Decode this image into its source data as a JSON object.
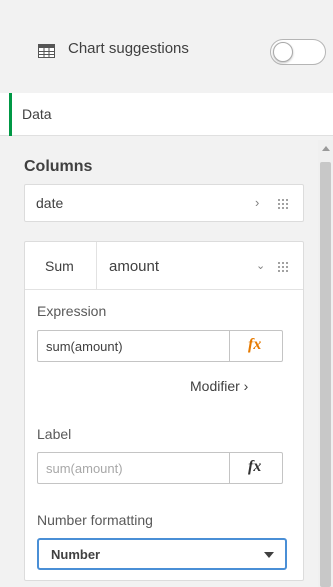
{
  "header": {
    "icon": "table-icon",
    "label": "Chart suggestions",
    "toggle_on": false
  },
  "tabs": {
    "data_label": "Data"
  },
  "columns": {
    "title": "Columns",
    "dimension": {
      "label": "date",
      "chevron": "›"
    }
  },
  "measure": {
    "aggregation": "Sum",
    "field": "amount",
    "chevron": "⌄",
    "expression": {
      "label": "Expression",
      "value": "sum(amount)",
      "fx": "fx",
      "fx_color": "#e67a00"
    },
    "modifier": "Modifier  ›",
    "label_section": {
      "label": "Label",
      "placeholder": "sum(amount)",
      "fx": "fx",
      "fx_color": "#333333"
    },
    "number_formatting": {
      "label": "Number formatting",
      "selected": "Number"
    }
  },
  "colors": {
    "accent_green": "#009845",
    "focus_blue": "#4a8fd6"
  }
}
